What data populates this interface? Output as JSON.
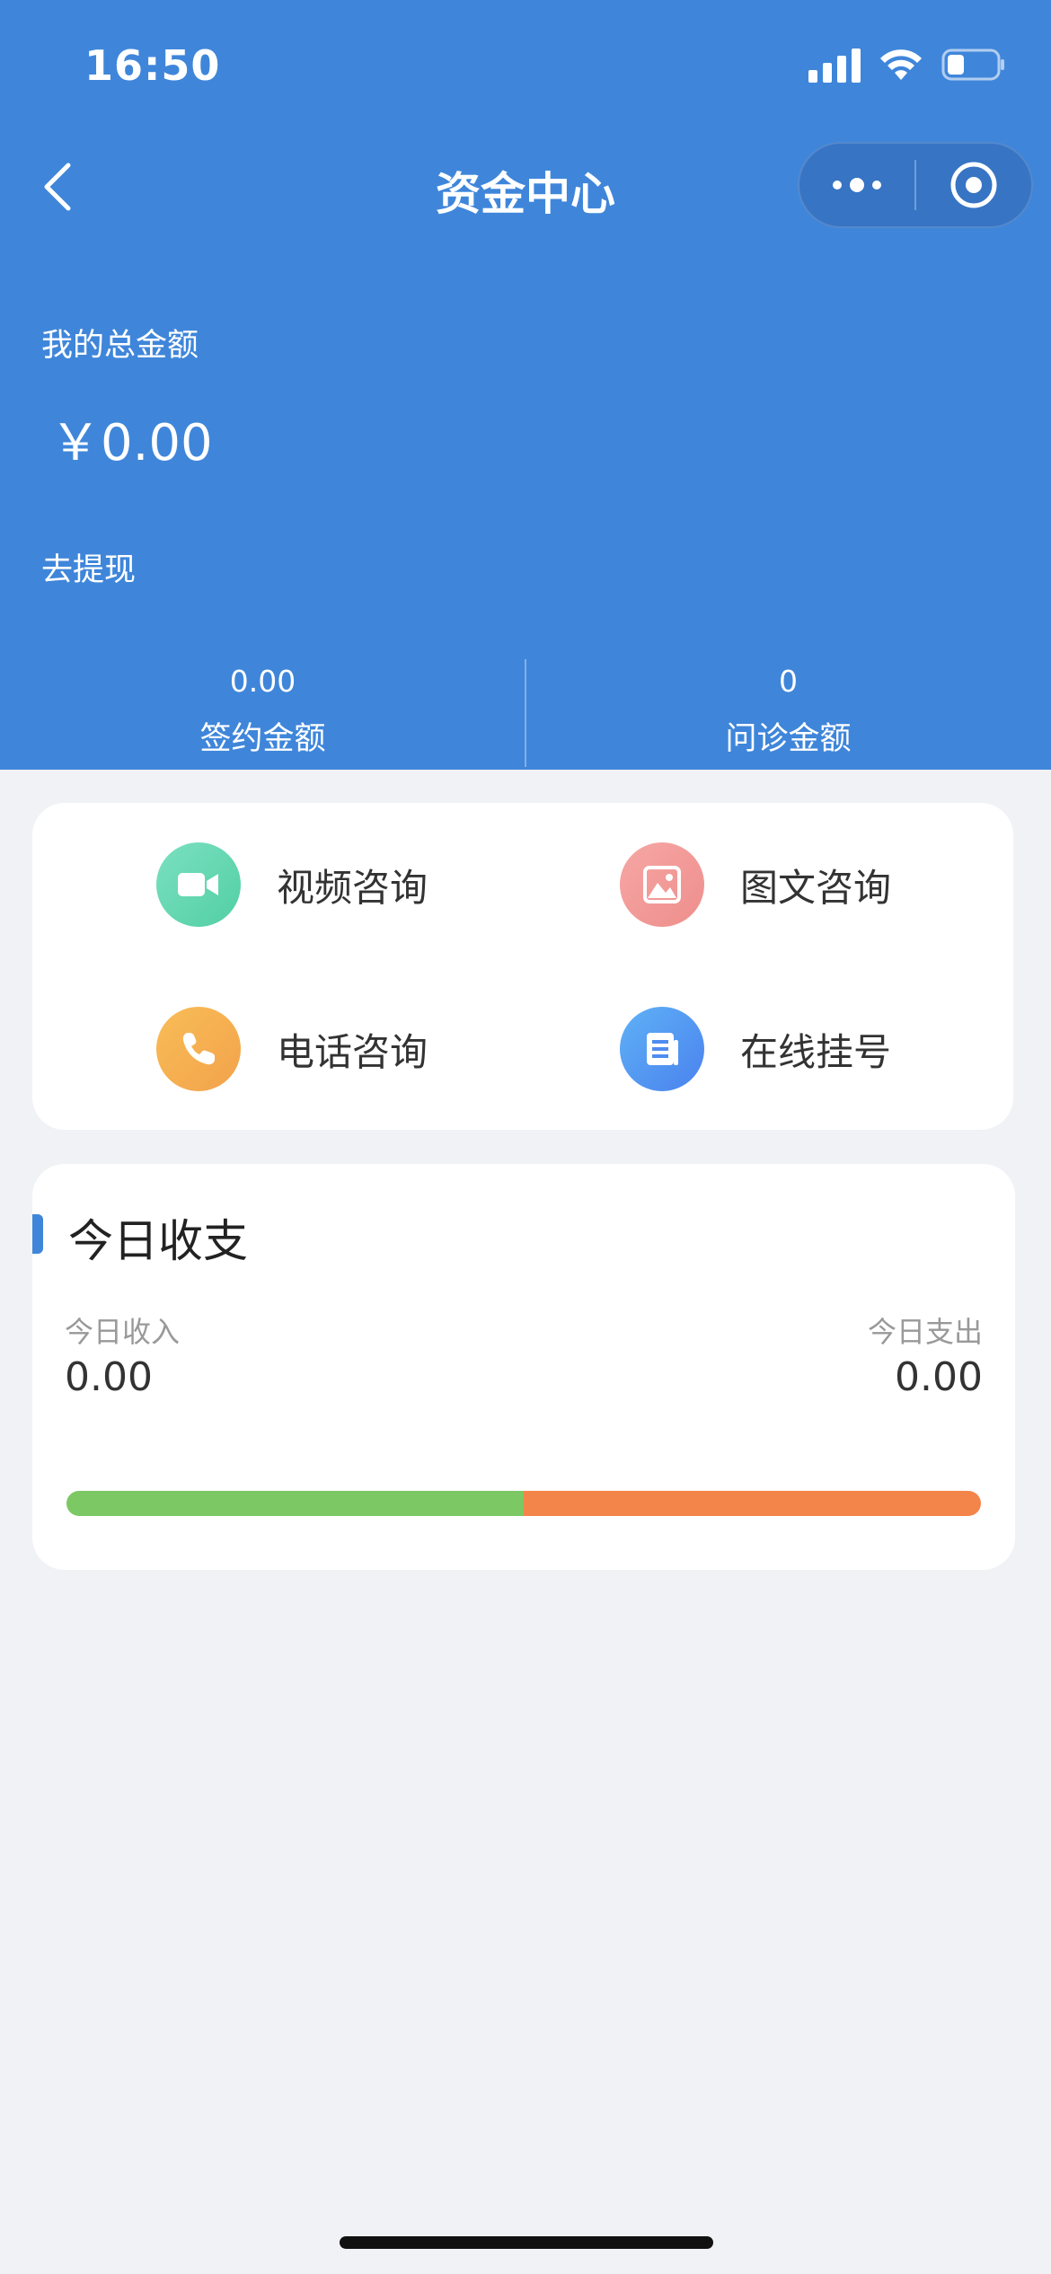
{
  "status_bar": {
    "time": "16:50"
  },
  "nav": {
    "title": "资金中心"
  },
  "summary": {
    "total_label": "我的总金额",
    "total_amount": "￥0.00",
    "withdraw_label": "去提现",
    "signed": {
      "value": "0.00",
      "label": "签约金额"
    },
    "consult": {
      "value": "0",
      "label": "问诊金额"
    }
  },
  "consult_menu": [
    {
      "label": "视频咨询",
      "icon": "video-camera-icon",
      "color_start": "#7be0c0",
      "color_end": "#52cfa4"
    },
    {
      "label": "图文咨询",
      "icon": "image-icon",
      "color_start": "#f6a7a5",
      "color_end": "#ee8e8c"
    },
    {
      "label": "电话咨询",
      "icon": "phone-icon",
      "color_start": "#f8bd57",
      "color_end": "#f3a24b"
    },
    {
      "label": "在线挂号",
      "icon": "document-icon",
      "color_start": "#5fb1f6",
      "color_end": "#4a82ee"
    }
  ],
  "today": {
    "title": "今日收支",
    "income_label": "今日收入",
    "income_value": "0.00",
    "expense_label": "今日支出",
    "expense_value": "0.00",
    "income_fraction": 0.5,
    "income_color": "#7cc864",
    "expense_color": "#f3854a"
  },
  "colors": {
    "primary": "#3f86da",
    "background": "#f1f2f6"
  }
}
